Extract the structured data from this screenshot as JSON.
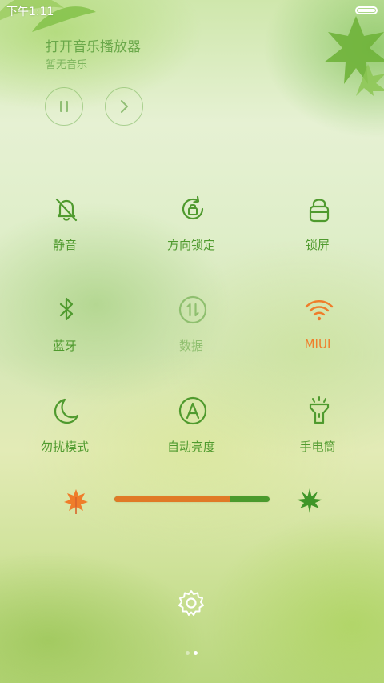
{
  "status_bar": {
    "time": "下午1:11",
    "battery_level": 1.0
  },
  "music": {
    "title": "打开音乐播放器",
    "subtitle": "暂无音乐",
    "pause_icon": "pause-icon",
    "next_icon": "next-icon"
  },
  "toggles": [
    {
      "label": "静音",
      "icon": "bell-off-icon",
      "state": "off"
    },
    {
      "label": "方向锁定",
      "icon": "rotation-lock-icon",
      "state": "off"
    },
    {
      "label": "锁屏",
      "icon": "lock-icon",
      "state": "off"
    },
    {
      "label": "蓝牙",
      "icon": "bluetooth-icon",
      "state": "off"
    },
    {
      "label": "数据",
      "icon": "mobile-data-icon",
      "state": "disabled"
    },
    {
      "label": "MIUI",
      "icon": "wifi-icon",
      "state": "on"
    },
    {
      "label": "勿扰模式",
      "icon": "moon-icon",
      "state": "off"
    },
    {
      "label": "自动亮度",
      "icon": "auto-brightness-icon",
      "state": "off"
    },
    {
      "label": "手电筒",
      "icon": "flashlight-icon",
      "state": "off"
    }
  ],
  "brightness": {
    "level": 0.74,
    "low_icon": "autumn-leaf-icon",
    "high_icon": "green-leaf-icon"
  },
  "settings": {
    "icon": "gear-icon"
  },
  "pager": {
    "pages": 2,
    "current": 2
  },
  "colors": {
    "icon_green": "#4f9a2e",
    "accent_orange": "#ef7d2a",
    "dim_green": "#8fbf6f",
    "slider_green": "#4a9a2c",
    "slider_orange": "#e07a26"
  }
}
